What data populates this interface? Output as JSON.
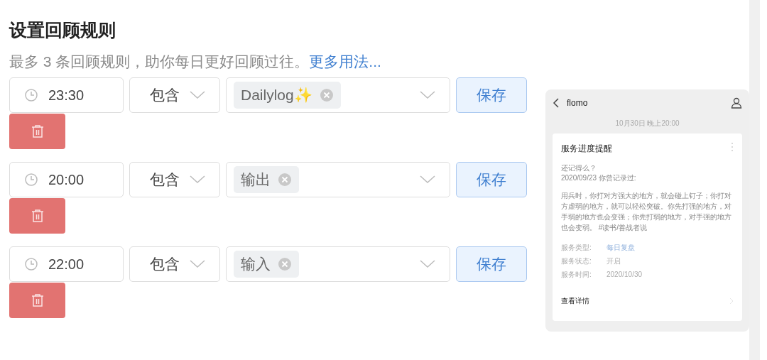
{
  "title": "设置回顾规则",
  "subtitle": {
    "text": "最多 3 条回顾规则，助你每日更好回顾过往。",
    "link": "更多用法..."
  },
  "rules": [
    {
      "time": "23:30",
      "condition": "包含",
      "tag": "Dailylog✨",
      "save": "保存"
    },
    {
      "time": "20:00",
      "condition": "包含",
      "tag": "输出",
      "save": "保存"
    },
    {
      "time": "22:00",
      "condition": "包含",
      "tag": "输入",
      "save": "保存"
    }
  ],
  "preview": {
    "app": "flomo",
    "timestamp": "10月30日 晚上20:00",
    "card_title": "服务进度提醒",
    "intro": [
      "还记得么？",
      "2020/09/23 你曾记录过:"
    ],
    "body": "用兵时，你打对方强大的地方，就会碰上钉子；你打对方虚弱的地方，就可以轻松突破。你先打强的地方，对手弱的地方也会变强；你先打弱的地方，对手强的地方也会变弱。 #读书/善战者说",
    "fields": [
      {
        "label": "服务类型:",
        "value": "每日复盘",
        "kind": "link"
      },
      {
        "label": "服务状态:",
        "value": "开启",
        "kind": "plain"
      },
      {
        "label": "服务时间:",
        "value": "2020/10/30",
        "kind": "plain"
      }
    ],
    "details": "查看详情"
  }
}
